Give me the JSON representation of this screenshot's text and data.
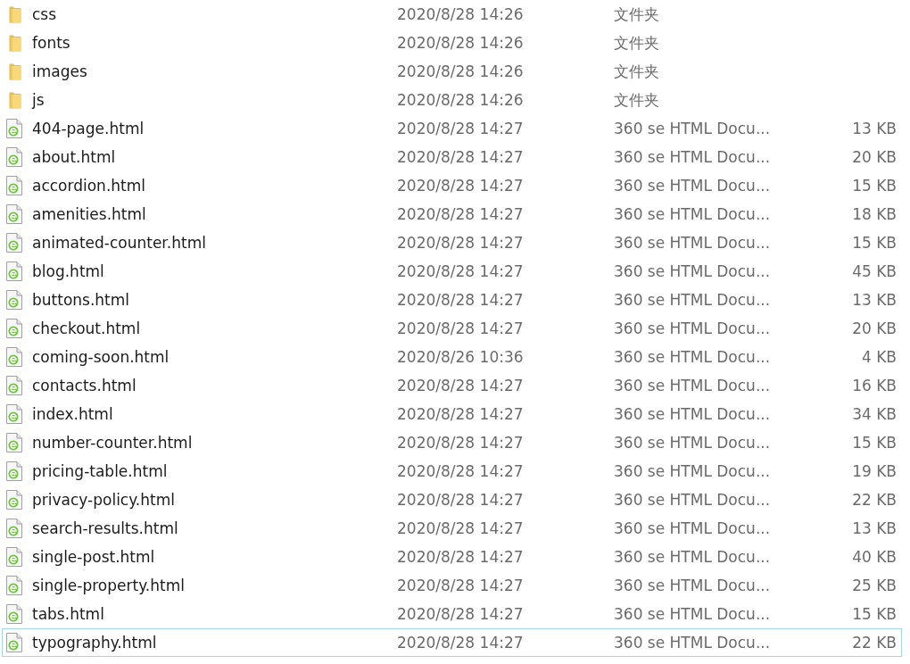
{
  "files": [
    {
      "kind": "folder",
      "name": "css",
      "modified": "2020/8/28 14:26",
      "type": "文件夹",
      "focused": false
    },
    {
      "kind": "folder",
      "name": "fonts",
      "modified": "2020/8/28 14:26",
      "type": "文件夹",
      "focused": false
    },
    {
      "kind": "folder",
      "name": "images",
      "modified": "2020/8/28 14:26",
      "type": "文件夹",
      "focused": false
    },
    {
      "kind": "folder",
      "name": "js",
      "modified": "2020/8/28 14:26",
      "type": "文件夹",
      "focused": false
    },
    {
      "kind": "html",
      "name": "404-page.html",
      "modified": "2020/8/28 14:27",
      "type": "360 se HTML Docu...",
      "size": "13 KB",
      "focused": false
    },
    {
      "kind": "html",
      "name": "about.html",
      "modified": "2020/8/28 14:27",
      "type": "360 se HTML Docu...",
      "size": "20 KB",
      "focused": false
    },
    {
      "kind": "html",
      "name": "accordion.html",
      "modified": "2020/8/28 14:27",
      "type": "360 se HTML Docu...",
      "size": "15 KB",
      "focused": false
    },
    {
      "kind": "html",
      "name": "amenities.html",
      "modified": "2020/8/28 14:27",
      "type": "360 se HTML Docu...",
      "size": "18 KB",
      "focused": false
    },
    {
      "kind": "html",
      "name": "animated-counter.html",
      "modified": "2020/8/28 14:27",
      "type": "360 se HTML Docu...",
      "size": "15 KB",
      "focused": false
    },
    {
      "kind": "html",
      "name": "blog.html",
      "modified": "2020/8/28 14:27",
      "type": "360 se HTML Docu...",
      "size": "45 KB",
      "focused": false
    },
    {
      "kind": "html",
      "name": "buttons.html",
      "modified": "2020/8/28 14:27",
      "type": "360 se HTML Docu...",
      "size": "13 KB",
      "focused": false
    },
    {
      "kind": "html",
      "name": "checkout.html",
      "modified": "2020/8/28 14:27",
      "type": "360 se HTML Docu...",
      "size": "20 KB",
      "focused": false
    },
    {
      "kind": "html",
      "name": "coming-soon.html",
      "modified": "2020/8/26 10:36",
      "type": "360 se HTML Docu...",
      "size": "4 KB",
      "focused": false
    },
    {
      "kind": "html",
      "name": "contacts.html",
      "modified": "2020/8/28 14:27",
      "type": "360 se HTML Docu...",
      "size": "16 KB",
      "focused": false
    },
    {
      "kind": "html",
      "name": "index.html",
      "modified": "2020/8/28 14:27",
      "type": "360 se HTML Docu...",
      "size": "34 KB",
      "focused": false
    },
    {
      "kind": "html",
      "name": "number-counter.html",
      "modified": "2020/8/28 14:27",
      "type": "360 se HTML Docu...",
      "size": "15 KB",
      "focused": false
    },
    {
      "kind": "html",
      "name": "pricing-table.html",
      "modified": "2020/8/28 14:27",
      "type": "360 se HTML Docu...",
      "size": "19 KB",
      "focused": false
    },
    {
      "kind": "html",
      "name": "privacy-policy.html",
      "modified": "2020/8/28 14:27",
      "type": "360 se HTML Docu...",
      "size": "22 KB",
      "focused": false
    },
    {
      "kind": "html",
      "name": "search-results.html",
      "modified": "2020/8/28 14:27",
      "type": "360 se HTML Docu...",
      "size": "13 KB",
      "focused": false
    },
    {
      "kind": "html",
      "name": "single-post.html",
      "modified": "2020/8/28 14:27",
      "type": "360 se HTML Docu...",
      "size": "40 KB",
      "focused": false
    },
    {
      "kind": "html",
      "name": "single-property.html",
      "modified": "2020/8/28 14:27",
      "type": "360 se HTML Docu...",
      "size": "25 KB",
      "focused": false
    },
    {
      "kind": "html",
      "name": "tabs.html",
      "modified": "2020/8/28 14:27",
      "type": "360 se HTML Docu...",
      "size": "15 KB",
      "focused": false
    },
    {
      "kind": "html",
      "name": "typography.html",
      "modified": "2020/8/28 14:27",
      "type": "360 se HTML Docu...",
      "size": "22 KB",
      "focused": true
    }
  ]
}
